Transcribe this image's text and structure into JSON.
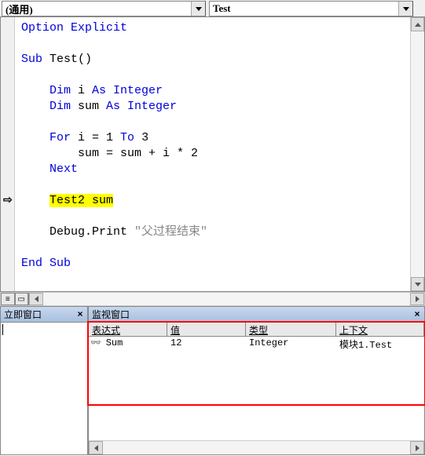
{
  "dropdowns": {
    "object_label": "(通用)",
    "proc_label": "Test"
  },
  "code": {
    "lines": [
      {
        "tokens": [
          {
            "t": "Option Explicit",
            "c": "kw"
          }
        ]
      },
      {
        "tokens": []
      },
      {
        "tokens": [
          {
            "t": "Sub ",
            "c": "kw"
          },
          {
            "t": "Test()",
            "c": "black"
          }
        ]
      },
      {
        "tokens": []
      },
      {
        "tokens": [
          {
            "t": "    ",
            "c": ""
          },
          {
            "t": "Dim ",
            "c": "kw"
          },
          {
            "t": "i ",
            "c": "black"
          },
          {
            "t": "As Integer",
            "c": "kw"
          }
        ]
      },
      {
        "tokens": [
          {
            "t": "    ",
            "c": ""
          },
          {
            "t": "Dim ",
            "c": "kw"
          },
          {
            "t": "sum ",
            "c": "black"
          },
          {
            "t": "As Integer",
            "c": "kw"
          }
        ]
      },
      {
        "tokens": []
      },
      {
        "tokens": [
          {
            "t": "    ",
            "c": ""
          },
          {
            "t": "For ",
            "c": "kw"
          },
          {
            "t": "i = 1 ",
            "c": "black"
          },
          {
            "t": "To ",
            "c": "kw"
          },
          {
            "t": "3",
            "c": "black"
          }
        ]
      },
      {
        "tokens": [
          {
            "t": "        sum = sum + i * 2",
            "c": "black"
          }
        ]
      },
      {
        "tokens": [
          {
            "t": "    ",
            "c": ""
          },
          {
            "t": "Next",
            "c": "kw"
          }
        ]
      },
      {
        "tokens": []
      },
      {
        "tokens": [
          {
            "t": "    ",
            "c": ""
          },
          {
            "t": "Test2 sum",
            "c": "black",
            "hl": true
          }
        ]
      },
      {
        "tokens": []
      },
      {
        "tokens": [
          {
            "t": "    ",
            "c": ""
          },
          {
            "t": "Debug",
            "c": "black"
          },
          {
            "t": ".Print ",
            "c": "black"
          },
          {
            "t": "\"父过程结束\"",
            "c": "str"
          }
        ]
      },
      {
        "tokens": []
      },
      {
        "tokens": [
          {
            "t": "End Sub",
            "c": "kw"
          }
        ]
      }
    ],
    "exec_line_index": 11,
    "exec_arrow": "⇨"
  },
  "immediate": {
    "title": "立即窗口",
    "content": ""
  },
  "watch": {
    "title": "监视窗口",
    "headers": {
      "expr": "表达式",
      "val": "值",
      "type": "类型",
      "ctx": "上下文"
    },
    "rows": [
      {
        "icon": "👓",
        "expr": "Sum",
        "val": "12",
        "type": "Integer",
        "ctx": "模块1.Test"
      }
    ]
  }
}
